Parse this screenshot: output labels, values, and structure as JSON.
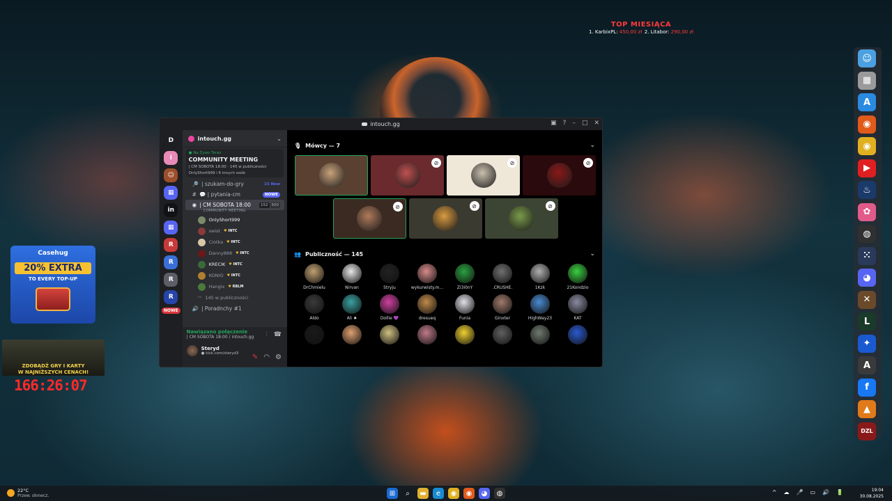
{
  "overlay": {
    "top_donations": {
      "title": "TOP MIESIĄCA",
      "entries": [
        {
          "name": "1. KarbixPL:",
          "amount": "450,00 zł"
        },
        {
          "name": "2. Litabor:",
          "amount": "290,00 zł"
        }
      ]
    },
    "casehug": {
      "brand": "Casehug",
      "extra": "20% EXTRA",
      "topup": "TO EVERY TOP-UP"
    },
    "games_banner": [
      "ZDOBĄDŹ GRY I KARTY",
      "W NAJNIŻSZYCH CENACH!"
    ],
    "timer": "166:26:07"
  },
  "window": {
    "title": "intouch.gg",
    "controls": {
      "pin": "▣",
      "help": "?",
      "minimize": "–",
      "maximize": "□",
      "close": "✕"
    }
  },
  "server_rail": {
    "items": [
      {
        "label": "D",
        "color": "#1e1f22"
      },
      {
        "label": "i",
        "color": "#e88ab8"
      },
      {
        "label": "☺",
        "color": "#9c4f2a"
      },
      {
        "label": "▦",
        "color": "#5865f2"
      },
      {
        "label": "in",
        "color": "#111214"
      },
      {
        "label": "▦",
        "color": "#5865f2"
      },
      {
        "label": "R",
        "color": "#c83a3a"
      },
      {
        "label": "R",
        "color": "#3a6fd8"
      },
      {
        "label": "R",
        "color": "#5b5e66"
      },
      {
        "label": "R",
        "color": "#2645a8"
      }
    ],
    "nowe_label": "NOWE"
  },
  "channels": {
    "server_name": "intouch.gg",
    "live": {
      "label": "● Na Żywo Teraz",
      "title": "COMMUNITY MEETING",
      "meta": "| CM SOBOTA 18:00 · 145 w publiczności",
      "hosts": "OnlyShort999 i 6 innych osób"
    },
    "list": [
      {
        "icon": "🔎",
        "name": "| szukam-do-gry",
        "badge": "15 New",
        "badge_pill": false
      },
      {
        "icon": "#",
        "name": "💬 | pytania-cm",
        "badge": "NOWE",
        "badge_pill": true
      }
    ],
    "stage_channel": {
      "name": "| CM SOBOTA 18:00",
      "count_a": "152",
      "count_b": "500",
      "sub": "COMMUNITY MEETING"
    },
    "voice_users": [
      {
        "name": "OnlyShort999",
        "tag": "",
        "me": true,
        "color": "#7d8a6a"
      },
      {
        "name": "swist",
        "tag": "INTC",
        "me": false,
        "color": "#8a3a3a"
      },
      {
        "name": "Ciotka",
        "tag": "INTC",
        "me": false,
        "color": "#d8c8a8"
      },
      {
        "name": "Danny888",
        "tag": "INTC",
        "me": false,
        "color": "#6a1818"
      },
      {
        "name": "KRECIK",
        "tag": "INTC",
        "me": true,
        "color": "#3a6a3a"
      },
      {
        "name": "KONIO",
        "tag": "INTC",
        "me": false,
        "color": "#b08030"
      },
      {
        "name": "Hangix",
        "tag": "RBLM",
        "me": false,
        "color": "#4a7a3a"
      }
    ],
    "audience_count": "145 w publiczności",
    "next_channel": "| Poradnchy #1",
    "voice_connected": "Nawiązano połączenie",
    "voice_where": "| CM SOBOTA 18:00 / intouch.gg",
    "user": {
      "name": "Steryd",
      "status": "● kick.com/steryd3"
    }
  },
  "stage": {
    "speakers_label": "Mówcy — 7",
    "audience_label": "Publiczność — 145",
    "speakers": [
      {
        "bg": "#5a4030",
        "av": "#c9a27a",
        "speaking": true,
        "muted": false
      },
      {
        "bg": "#6a2a2e",
        "av": "#c05050",
        "speaking": false,
        "muted": true
      },
      {
        "bg": "#efe7d8",
        "av": "#c9bfae",
        "speaking": false,
        "muted": true
      },
      {
        "bg": "#2a0a0c",
        "av": "#8a1818",
        "speaking": false,
        "muted": true
      },
      {
        "bg": "#3a2a22",
        "av": "#b07a5a",
        "speaking": true,
        "muted": true
      },
      {
        "bg": "#3a3a30",
        "av": "#d89a40",
        "speaking": false,
        "muted": true
      },
      {
        "bg": "#3c4434",
        "av": "#7a9a4a",
        "speaking": false,
        "muted": true
      }
    ],
    "audience": [
      {
        "name": "DrChmielu",
        "color": "#c0a070"
      },
      {
        "name": "Nirvan",
        "color": "#e8e8e8"
      },
      {
        "name": "Stryju",
        "color": "#222222"
      },
      {
        "name": "wykurwisty.m...",
        "color": "#d88a8a"
      },
      {
        "name": "Zi3i0nY",
        "color": "#2aa040"
      },
      {
        "name": ".CRUSHE.",
        "color": "#707070"
      },
      {
        "name": "1Kzk",
        "color": "#b0b0b0"
      },
      {
        "name": "21Kondzio",
        "color": "#3ad040"
      },
      {
        "name": "Aldo",
        "color": "#3a3a3a"
      },
      {
        "name": "Ali ♠",
        "color": "#3aa0a0"
      },
      {
        "name": "Dollie 💜",
        "color": "#d040a0"
      },
      {
        "name": "dresueq",
        "color": "#c08a4a"
      },
      {
        "name": "Funia",
        "color": "#e0e0e8"
      },
      {
        "name": "Ginxter",
        "color": "#a07a6a"
      },
      {
        "name": "HighWay23",
        "color": "#4a8ad0"
      },
      {
        "name": "KAT",
        "color": "#8a8aa0"
      },
      {
        "name": "",
        "color": "#1a1a1a"
      },
      {
        "name": "",
        "color": "#e0a070"
      },
      {
        "name": "",
        "color": "#d0c080"
      },
      {
        "name": "",
        "color": "#c07a8a"
      },
      {
        "name": "",
        "color": "#f0d030"
      },
      {
        "name": "",
        "color": "#606060"
      },
      {
        "name": "",
        "color": "#707a70"
      },
      {
        "name": "",
        "color": "#2a5ad0"
      }
    ]
  },
  "dock": [
    {
      "label": "☺",
      "color": "#4aa0e0"
    },
    {
      "label": "▦",
      "color": "#9a9a9a"
    },
    {
      "label": "A",
      "color": "#2a8ae0"
    },
    {
      "label": "◉",
      "color": "#e05a1a"
    },
    {
      "label": "◉",
      "color": "#e0b020"
    },
    {
      "label": "▶",
      "color": "#e02020"
    },
    {
      "label": "♨",
      "color": "#1a3a6a"
    },
    {
      "label": "✿",
      "color": "#e05a8a"
    },
    {
      "label": "◍",
      "color": "#303030"
    },
    {
      "label": "⁙",
      "color": "#2a3a5a"
    },
    {
      "label": "◕",
      "color": "#5865f2"
    },
    {
      "label": "✕",
      "color": "#6a4a2a"
    },
    {
      "label": "L",
      "color": "#1a3a2a"
    },
    {
      "label": "✦",
      "color": "#1a5ad0"
    },
    {
      "label": "A",
      "color": "#3a3a3a"
    },
    {
      "label": "f",
      "color": "#1877f2"
    },
    {
      "label": "▲",
      "color": "#e07a1a"
    },
    {
      "label": "DZL",
      "color": "#8a1a1a"
    }
  ],
  "taskbar": {
    "weather_temp": "22°C",
    "weather_desc": "Przew. słonecz.",
    "time": "19:04",
    "date": "30.08.2025",
    "icons": [
      {
        "label": "⊞",
        "color": "#1a6ad0"
      },
      {
        "label": "⌕",
        "color": "transparent"
      },
      {
        "label": "▬",
        "color": "#e0b030"
      },
      {
        "label": "e",
        "color": "#1a8ad0"
      },
      {
        "label": "◉",
        "color": "#e0b020"
      },
      {
        "label": "◉",
        "color": "#e05a1a"
      },
      {
        "label": "◕",
        "color": "#5865f2"
      },
      {
        "label": "◍",
        "color": "#303030"
      }
    ],
    "tray": [
      "^",
      "☁",
      "🎤",
      "▭",
      "🔊",
      "🔋"
    ]
  }
}
